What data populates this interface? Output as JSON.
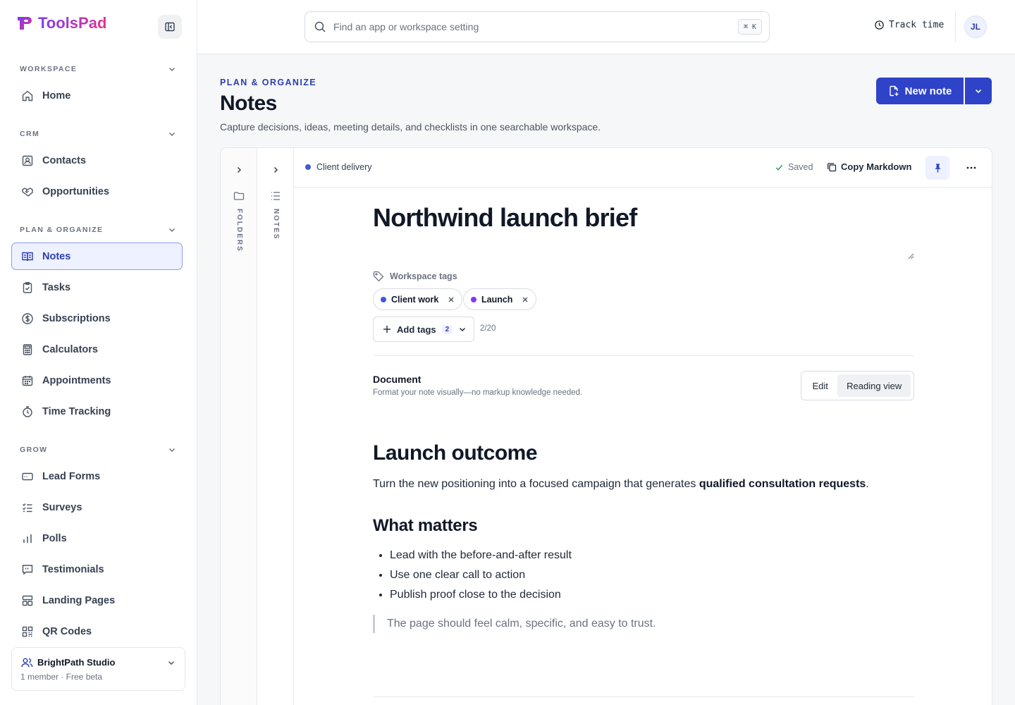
{
  "app": {
    "name": "ToolsPad"
  },
  "sidebar": {
    "sections": [
      {
        "label": "WORKSPACE",
        "items": [
          {
            "label": "Home",
            "icon": "home-icon"
          }
        ]
      },
      {
        "label": "CRM",
        "items": [
          {
            "label": "Contacts",
            "icon": "contacts-icon"
          },
          {
            "label": "Opportunities",
            "icon": "handshake-icon"
          }
        ]
      },
      {
        "label": "PLAN & ORGANIZE",
        "items": [
          {
            "label": "Notes",
            "icon": "notes-icon",
            "active": true
          },
          {
            "label": "Tasks",
            "icon": "clipboard-check-icon"
          },
          {
            "label": "Subscriptions",
            "icon": "dollar-circle-icon"
          },
          {
            "label": "Calculators",
            "icon": "calculator-icon"
          },
          {
            "label": "Appointments",
            "icon": "calendar-icon"
          },
          {
            "label": "Time Tracking",
            "icon": "stopwatch-icon"
          }
        ]
      },
      {
        "label": "GROW",
        "items": [
          {
            "label": "Lead Forms",
            "icon": "form-icon"
          },
          {
            "label": "Surveys",
            "icon": "checklist-icon"
          },
          {
            "label": "Polls",
            "icon": "bar-chart-icon"
          },
          {
            "label": "Testimonials",
            "icon": "quote-bubble-icon"
          },
          {
            "label": "Landing Pages",
            "icon": "layout-icon"
          },
          {
            "label": "QR Codes",
            "icon": "qr-code-icon"
          }
        ]
      }
    ],
    "team": {
      "name": "BrightPath Studio",
      "meta": "1 member · Free beta"
    }
  },
  "topbar": {
    "search_placeholder": "Find an app or workspace setting",
    "shortcut": "⌘ K",
    "track_time": "Track time",
    "avatar_initials": "JL"
  },
  "page": {
    "eyebrow": "PLAN & ORGANIZE",
    "title": "Notes",
    "description": "Capture decisions, ideas, meeting details, and checklists in one searchable workspace.",
    "new_note": "New note"
  },
  "panel": {
    "rail_folders": "FOLDERS",
    "rail_notes": "NOTES",
    "folder": "Client delivery",
    "saved": "Saved",
    "copy_markdown": "Copy Markdown"
  },
  "note": {
    "title": "Northwind launch brief",
    "tags_label": "Workspace tags",
    "tags": [
      {
        "label": "Client work",
        "color": "#3b5bdb"
      },
      {
        "label": "Launch",
        "color": "#7c3aed"
      }
    ],
    "add_tags": "Add tags",
    "add_tags_count": "2",
    "tag_limit": "2/20",
    "document_label": "Document",
    "document_sub": "Format your note visually—no markup knowledge needed.",
    "mode_edit": "Edit",
    "mode_reading": "Reading view",
    "body": {
      "h1": "Launch outcome",
      "p1_before": "Turn the new positioning into a focused campaign that generates ",
      "p1_bold": "qualified consultation requests",
      "p1_after": ".",
      "h2": "What matters",
      "bullets": [
        "Lead with the before-and-after result",
        "Use one clear call to action",
        "Publish proof close to the decision"
      ],
      "quote": "The page should feel calm, specific, and easy to trust."
    }
  },
  "colors": {
    "accent": "#2f43c8",
    "active_bg": "#eef1ff",
    "active_border": "#8c9af0"
  }
}
